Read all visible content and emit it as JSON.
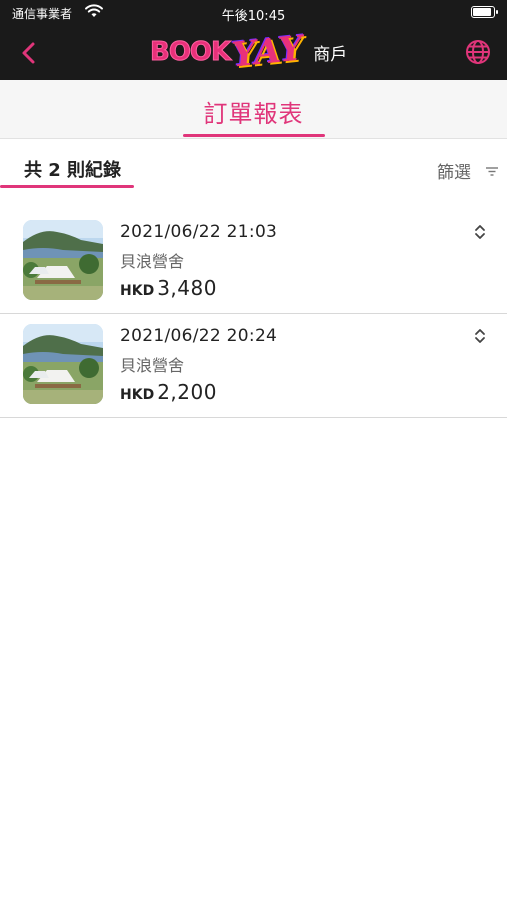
{
  "status_bar": {
    "carrier": "通信事業者",
    "time": "午後10:45"
  },
  "nav": {
    "logo_book": "BOOK",
    "logo_yay": "YAY",
    "logo_subtitle": "商戶",
    "back_icon": "chevron-left-icon",
    "language_icon": "globe-icon"
  },
  "page": {
    "title": "訂單報表"
  },
  "summary": {
    "record_count": "共 2 則紀錄",
    "filter_label": "篩選",
    "filter_icon": "filter-icon"
  },
  "records": [
    {
      "datetime": "2021/06/22 21:03",
      "place": "貝浪營舍",
      "currency": "HKD",
      "amount": "3,480"
    },
    {
      "datetime": "2021/06/22 20:24",
      "place": "貝浪營舍",
      "currency": "HKD",
      "amount": "2,200"
    }
  ],
  "colors": {
    "accent": "#e0357a",
    "header_bg": "#1a1a1a"
  }
}
